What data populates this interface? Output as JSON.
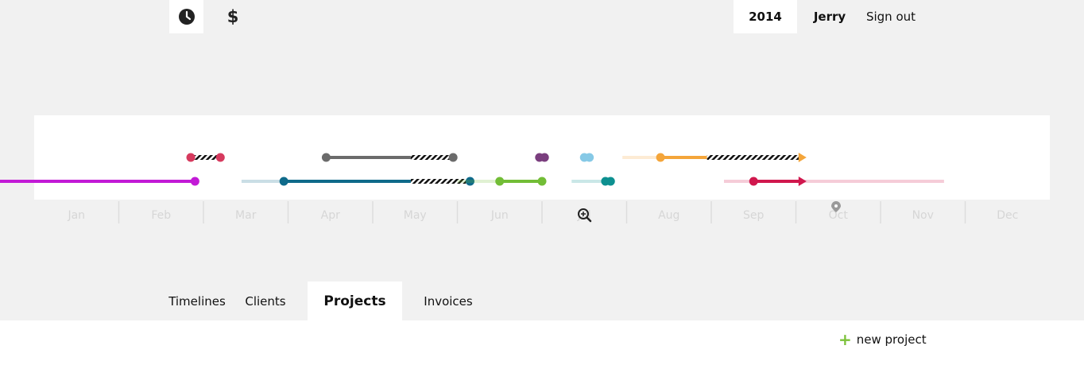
{
  "nav": {
    "clock_icon": "clock-icon",
    "dollar_label": "$",
    "year": "2014",
    "user": "Jerry",
    "signout": "Sign out"
  },
  "timeline": {
    "months": [
      "Jan",
      "Feb",
      "Mar",
      "Apr",
      "May",
      "Jun",
      "Jul",
      "Aug",
      "Sep",
      "Oct",
      "Nov",
      "Dec"
    ],
    "zoom_icon": "zoom-in-icon",
    "today_marker_icon": "location-pin-icon",
    "projects": [
      {
        "name": "project-magenta",
        "color": "#c21ad6",
        "row": 2,
        "start_month": 0.0,
        "solid_end_month": 1.9,
        "end_month": 1.9,
        "marker_end": "dot",
        "light_before": 0.0
      },
      {
        "name": "project-crimson-early",
        "color": "#d63a5e",
        "row": 1,
        "start_month": 1.85,
        "solid_end_month": 1.85,
        "end_month": 2.2,
        "marker_end": "dot",
        "light_before": 0.0
      },
      {
        "name": "project-teal-dark",
        "color": "#0e6a8a",
        "row": 2,
        "start_month": 2.95,
        "solid_end_month": 4.45,
        "end_month": 5.15,
        "marker_end": "dot",
        "light_before": 2.45
      },
      {
        "name": "project-gray",
        "color": "#6b6b6b",
        "row": 1,
        "start_month": 3.45,
        "solid_end_month": 4.45,
        "end_month": 4.95,
        "marker_end": "dot",
        "light_before": 0.0
      },
      {
        "name": "project-green",
        "color": "#72bd36",
        "row": 2,
        "start_month": 5.5,
        "solid_end_month": 6.0,
        "end_month": 6.0,
        "marker_end": "dot",
        "light_before": 5.0
      },
      {
        "name": "project-purple",
        "color": "#7a3e7e",
        "row": 1,
        "start_month": 5.97,
        "solid_end_month": 6.03,
        "end_month": 6.03,
        "marker_end": "dot",
        "light_before": 0.0
      },
      {
        "name": "project-skyblue",
        "color": "#86c9e6",
        "row": 1,
        "start_month": 6.5,
        "solid_end_month": 6.56,
        "end_month": 6.56,
        "marker_end": "dot",
        "light_before": 0.0
      },
      {
        "name": "project-teal-small",
        "color": "#0d9090",
        "row": 2,
        "start_month": 6.75,
        "solid_end_month": 6.81,
        "end_month": 6.81,
        "marker_end": "dot",
        "light_before": 6.35
      },
      {
        "name": "project-orange",
        "color": "#f4a53a",
        "row": 1,
        "start_month": 7.4,
        "solid_end_month": 7.95,
        "end_month": 9.05,
        "marker_end": "arrow",
        "light_before": 6.95
      },
      {
        "name": "project-red",
        "color": "#d0174d",
        "row": 2,
        "start_month": 8.5,
        "solid_end_month": 9.05,
        "end_month": 9.05,
        "marker_end": "arrow",
        "light_before": 8.15,
        "light_after": 10.75
      }
    ]
  },
  "tabs": {
    "timelines": "Timelines",
    "clients": "Clients",
    "projects": "Projects",
    "invoices": "Invoices"
  },
  "actions": {
    "new_project": "new project",
    "plus": "+"
  }
}
